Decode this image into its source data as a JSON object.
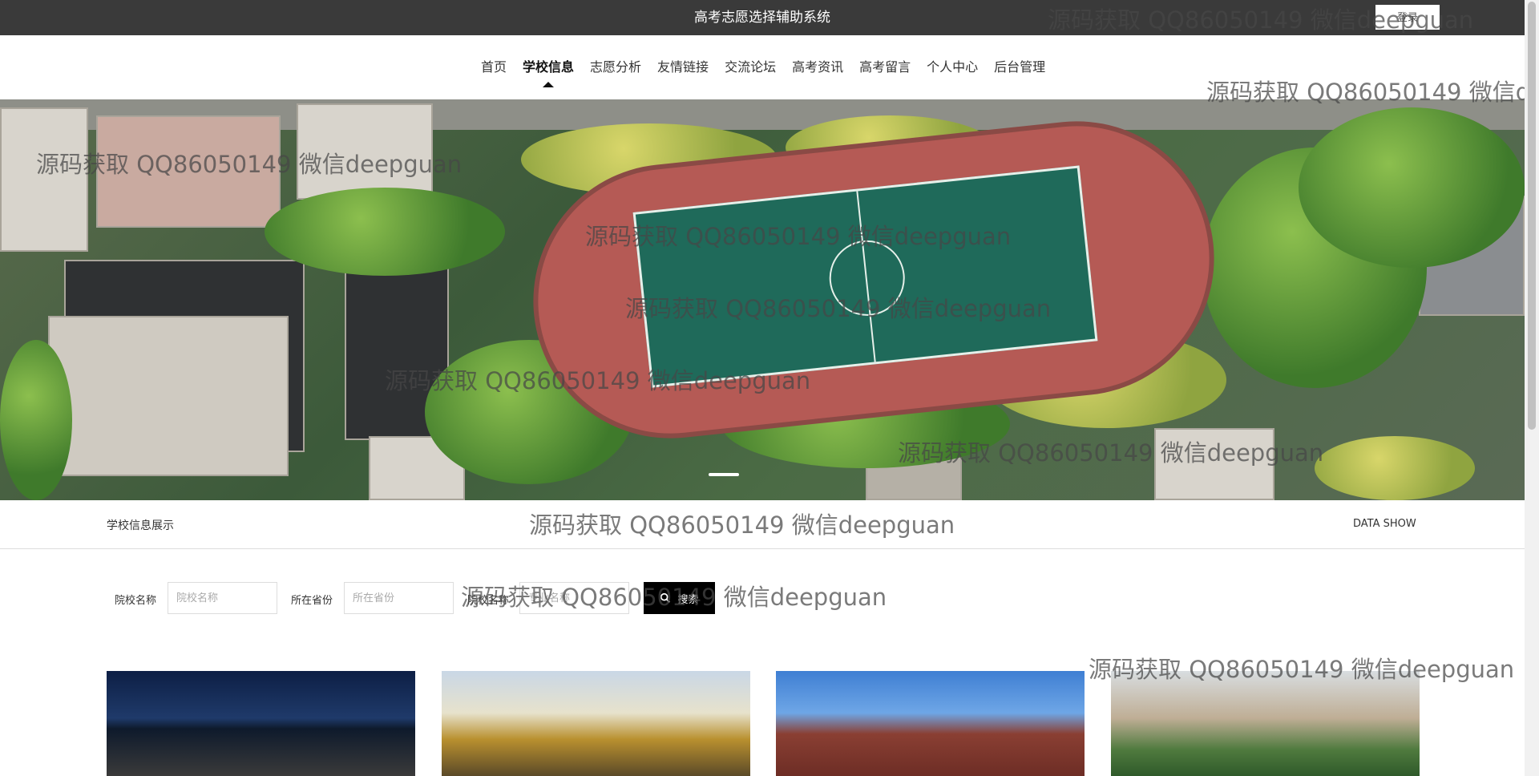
{
  "header": {
    "title": "高考志愿选择辅助系统",
    "login_label": "登录"
  },
  "nav": {
    "items": [
      {
        "label": "首页",
        "active": false
      },
      {
        "label": "学校信息",
        "active": true
      },
      {
        "label": "志愿分析",
        "active": false
      },
      {
        "label": "友情链接",
        "active": false
      },
      {
        "label": "交流论坛",
        "active": false
      },
      {
        "label": "高考资讯",
        "active": false
      },
      {
        "label": "高考留言",
        "active": false
      },
      {
        "label": "个人中心",
        "active": false
      },
      {
        "label": "后台管理",
        "active": false
      }
    ]
  },
  "banner": {
    "slide_count": 1,
    "active_slide": 1
  },
  "section": {
    "title": "学校信息展示",
    "subtitle": "DATA SHOW"
  },
  "search": {
    "school_name_label": "院校名称",
    "school_name_placeholder": "院校名称",
    "province_label": "所在省份",
    "province_placeholder": "所在省份",
    "third_label": "院校名称",
    "third_placeholder": "专业名称",
    "button_label": "搜索"
  },
  "watermark": {
    "text": "源码获取 QQ86050149 微信deepguan"
  },
  "colors": {
    "topbar": "#3a3a3a",
    "search_button": "#000000"
  }
}
